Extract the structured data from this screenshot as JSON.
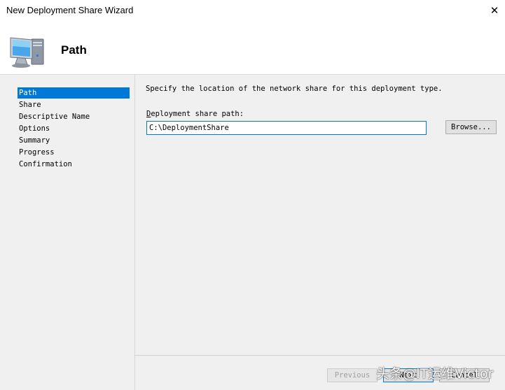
{
  "window": {
    "title": "New Deployment Share Wizard",
    "close_icon": "close-icon"
  },
  "header": {
    "icon": "computer-icon",
    "page_title": "Path"
  },
  "sidebar": {
    "items": [
      {
        "label": "Path",
        "selected": true
      },
      {
        "label": "Share",
        "selected": false
      },
      {
        "label": "Descriptive Name",
        "selected": false
      },
      {
        "label": "Options",
        "selected": false
      },
      {
        "label": "Summary",
        "selected": false
      },
      {
        "label": "Progress",
        "selected": false
      },
      {
        "label": "Confirmation",
        "selected": false
      }
    ]
  },
  "main": {
    "instruction": "Specify the location of the network share for this deployment type.",
    "field_label_access_key": "D",
    "field_label_rest": "eployment share path:",
    "path_value": "C:\\DeploymentShare",
    "browse_label": "Browse..."
  },
  "footer": {
    "previous_label": "Previous",
    "next_label": "Next",
    "cancel_label": "Cancel"
  },
  "watermark": "头条@IT运维Victor",
  "colors": {
    "selection": "#0078d7",
    "panel_bg": "#f0f0f0"
  }
}
